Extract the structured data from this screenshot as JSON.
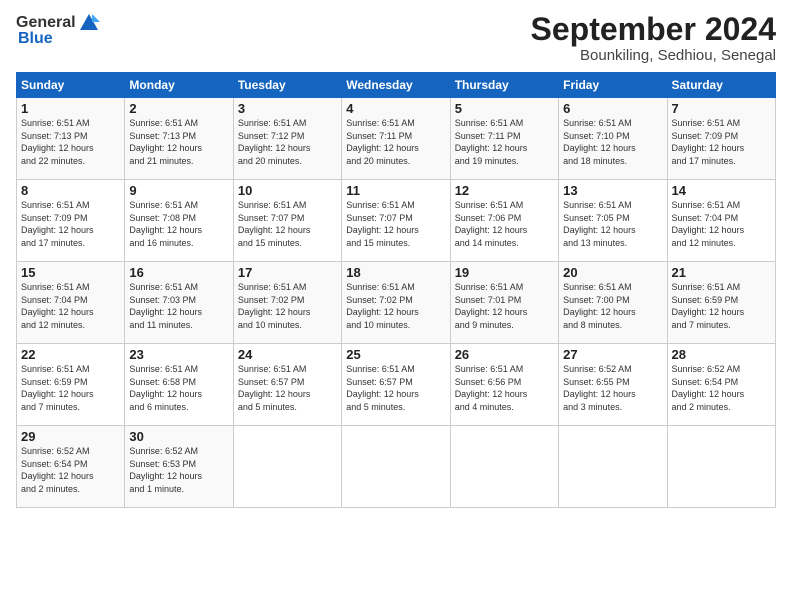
{
  "header": {
    "logo_general": "General",
    "logo_blue": "Blue",
    "month": "September 2024",
    "location": "Bounkiling, Sedhiou, Senegal"
  },
  "weekdays": [
    "Sunday",
    "Monday",
    "Tuesday",
    "Wednesday",
    "Thursday",
    "Friday",
    "Saturday"
  ],
  "weeks": [
    [
      {
        "day": 1,
        "info": "Sunrise: 6:51 AM\nSunset: 7:13 PM\nDaylight: 12 hours\nand 22 minutes."
      },
      {
        "day": 2,
        "info": "Sunrise: 6:51 AM\nSunset: 7:13 PM\nDaylight: 12 hours\nand 21 minutes."
      },
      {
        "day": 3,
        "info": "Sunrise: 6:51 AM\nSunset: 7:12 PM\nDaylight: 12 hours\nand 20 minutes."
      },
      {
        "day": 4,
        "info": "Sunrise: 6:51 AM\nSunset: 7:11 PM\nDaylight: 12 hours\nand 20 minutes."
      },
      {
        "day": 5,
        "info": "Sunrise: 6:51 AM\nSunset: 7:11 PM\nDaylight: 12 hours\nand 19 minutes."
      },
      {
        "day": 6,
        "info": "Sunrise: 6:51 AM\nSunset: 7:10 PM\nDaylight: 12 hours\nand 18 minutes."
      },
      {
        "day": 7,
        "info": "Sunrise: 6:51 AM\nSunset: 7:09 PM\nDaylight: 12 hours\nand 17 minutes."
      }
    ],
    [
      {
        "day": 8,
        "info": "Sunrise: 6:51 AM\nSunset: 7:09 PM\nDaylight: 12 hours\nand 17 minutes."
      },
      {
        "day": 9,
        "info": "Sunrise: 6:51 AM\nSunset: 7:08 PM\nDaylight: 12 hours\nand 16 minutes."
      },
      {
        "day": 10,
        "info": "Sunrise: 6:51 AM\nSunset: 7:07 PM\nDaylight: 12 hours\nand 15 minutes."
      },
      {
        "day": 11,
        "info": "Sunrise: 6:51 AM\nSunset: 7:07 PM\nDaylight: 12 hours\nand 15 minutes."
      },
      {
        "day": 12,
        "info": "Sunrise: 6:51 AM\nSunset: 7:06 PM\nDaylight: 12 hours\nand 14 minutes."
      },
      {
        "day": 13,
        "info": "Sunrise: 6:51 AM\nSunset: 7:05 PM\nDaylight: 12 hours\nand 13 minutes."
      },
      {
        "day": 14,
        "info": "Sunrise: 6:51 AM\nSunset: 7:04 PM\nDaylight: 12 hours\nand 12 minutes."
      }
    ],
    [
      {
        "day": 15,
        "info": "Sunrise: 6:51 AM\nSunset: 7:04 PM\nDaylight: 12 hours\nand 12 minutes."
      },
      {
        "day": 16,
        "info": "Sunrise: 6:51 AM\nSunset: 7:03 PM\nDaylight: 12 hours\nand 11 minutes."
      },
      {
        "day": 17,
        "info": "Sunrise: 6:51 AM\nSunset: 7:02 PM\nDaylight: 12 hours\nand 10 minutes."
      },
      {
        "day": 18,
        "info": "Sunrise: 6:51 AM\nSunset: 7:02 PM\nDaylight: 12 hours\nand 10 minutes."
      },
      {
        "day": 19,
        "info": "Sunrise: 6:51 AM\nSunset: 7:01 PM\nDaylight: 12 hours\nand 9 minutes."
      },
      {
        "day": 20,
        "info": "Sunrise: 6:51 AM\nSunset: 7:00 PM\nDaylight: 12 hours\nand 8 minutes."
      },
      {
        "day": 21,
        "info": "Sunrise: 6:51 AM\nSunset: 6:59 PM\nDaylight: 12 hours\nand 7 minutes."
      }
    ],
    [
      {
        "day": 22,
        "info": "Sunrise: 6:51 AM\nSunset: 6:59 PM\nDaylight: 12 hours\nand 7 minutes."
      },
      {
        "day": 23,
        "info": "Sunrise: 6:51 AM\nSunset: 6:58 PM\nDaylight: 12 hours\nand 6 minutes."
      },
      {
        "day": 24,
        "info": "Sunrise: 6:51 AM\nSunset: 6:57 PM\nDaylight: 12 hours\nand 5 minutes."
      },
      {
        "day": 25,
        "info": "Sunrise: 6:51 AM\nSunset: 6:57 PM\nDaylight: 12 hours\nand 5 minutes."
      },
      {
        "day": 26,
        "info": "Sunrise: 6:51 AM\nSunset: 6:56 PM\nDaylight: 12 hours\nand 4 minutes."
      },
      {
        "day": 27,
        "info": "Sunrise: 6:52 AM\nSunset: 6:55 PM\nDaylight: 12 hours\nand 3 minutes."
      },
      {
        "day": 28,
        "info": "Sunrise: 6:52 AM\nSunset: 6:54 PM\nDaylight: 12 hours\nand 2 minutes."
      }
    ],
    [
      {
        "day": 29,
        "info": "Sunrise: 6:52 AM\nSunset: 6:54 PM\nDaylight: 12 hours\nand 2 minutes."
      },
      {
        "day": 30,
        "info": "Sunrise: 6:52 AM\nSunset: 6:53 PM\nDaylight: 12 hours\nand 1 minute."
      },
      null,
      null,
      null,
      null,
      null
    ]
  ]
}
